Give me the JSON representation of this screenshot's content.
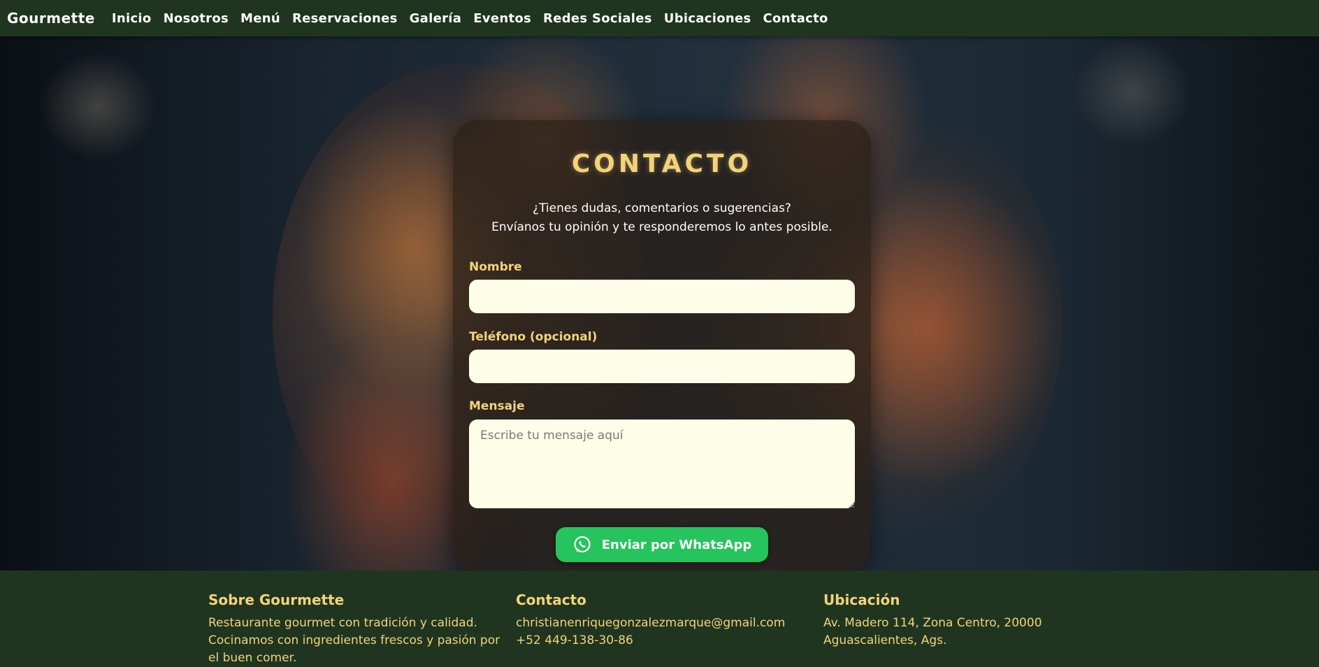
{
  "navbar": {
    "brand": "Gourmette",
    "links": [
      "Inicio",
      "Nosotros",
      "Menú",
      "Reservaciones",
      "Galería",
      "Eventos",
      "Redes Sociales",
      "Ubicaciones",
      "Contacto"
    ]
  },
  "contact": {
    "title": "CONTACTO",
    "subtitle_line1": "¿Tienes dudas, comentarios o sugerencias?",
    "subtitle_line2": "Envíanos tu opinión y te responderemos lo antes posible.",
    "name_label": "Nombre",
    "name_value": "",
    "phone_label": "Teléfono (opcional)",
    "phone_value": "",
    "message_label": "Mensaje",
    "message_placeholder": "Escribe tu mensaje aquí",
    "submit_label": "Enviar por WhatsApp",
    "submit_icon": "whatsapp-icon"
  },
  "footer": {
    "about_heading": "Sobre Gourmette",
    "about_line1": "Restaurante gourmet con tradición y calidad.",
    "about_line2": "Cocinamos con ingredientes frescos y pasión por",
    "about_line3": "el buen comer.",
    "contact_heading": "Contacto",
    "contact_email": "christianenriquegonzalezmarque@gmail.com",
    "contact_phone": "+52 449-138-30-86",
    "location_heading": "Ubicación",
    "location_line1": "Av. Madero 114, Zona Centro, 20000",
    "location_line2": "Aguascalientes, Ags."
  },
  "colors": {
    "nav_bg": "#1f3520",
    "accent_gold": "#f3d37a",
    "input_bg": "#fefde8",
    "whatsapp_green": "#25c45c"
  }
}
